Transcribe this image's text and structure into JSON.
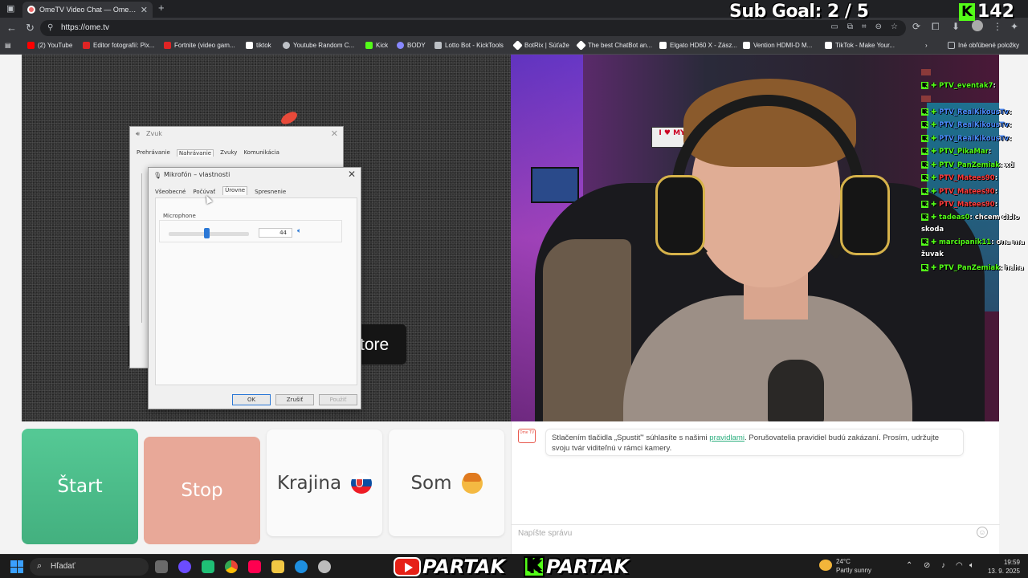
{
  "browser": {
    "tab_title": "OmeTV Video Chat — Ome…",
    "url": "https://ome.tv",
    "bookmarks": [
      {
        "label": "(2) YouTube",
        "color": "#ff0000"
      },
      {
        "label": "Editor fotografií: Pix...",
        "color": "#e02424"
      },
      {
        "label": "Fortnite (video gam...",
        "color": "#e02424"
      },
      {
        "label": "tiktok",
        "color": "#ffffff"
      },
      {
        "label": "Youtube Random C...",
        "color": "#bdc1c6"
      },
      {
        "label": "Kick",
        "color": "#53fc18"
      },
      {
        "label": "BODY",
        "color": "#8888ff"
      },
      {
        "label": "Lotto Bot - KickTools",
        "color": "#bdc1c6"
      },
      {
        "label": "BotRix | Súťaže",
        "color": "#ffffff"
      },
      {
        "label": "The best ChatBot an...",
        "color": "#ffffff"
      },
      {
        "label": "Elgato HD60 X - Zász...",
        "color": "#ffffff"
      },
      {
        "label": "Vention HDMI-D M...",
        "color": "#ffffff"
      },
      {
        "label": "TikTok - Make Your...",
        "color": "#ffffff"
      }
    ],
    "other_bookmarks": "Iné obľúbené položky"
  },
  "overlay": {
    "sub_goal": "Sub Goal:  2 / 5",
    "viewer_k": "K",
    "viewer_count": "142"
  },
  "dialogs": {
    "zvuk": {
      "title": "Zvuk",
      "tabs": [
        "Prehrávanie",
        "Nahrávanie",
        "Zvuky",
        "Komunikácia"
      ],
      "active_tab": 1
    },
    "mikrofon": {
      "title": "Mikrofón – vlastnosti",
      "tabs": [
        "Všeobecné",
        "Počúvať",
        "Úrovne",
        "Spresnenie"
      ],
      "active_tab": 2,
      "group_label": "Microphone",
      "level_value": "44",
      "level": 0.44,
      "buttons": {
        "ok": "OK",
        "cancel": "Zrušiť",
        "apply": "Použiť"
      }
    }
  },
  "video": {
    "store_fragment": "tore",
    "poster_text": "I ♥ MY"
  },
  "chat_overlay": [
    {
      "user": "",
      "text": "",
      "user_color": "green",
      "badges": "emote"
    },
    {
      "user": "PTV_eventak7",
      "text": ":",
      "user_color": "green",
      "badges": "k+"
    },
    {
      "user": "",
      "text": "",
      "user_color": "green",
      "badges": "emote"
    },
    {
      "user": "PTV_RealKikousTv",
      "text": ":",
      "user_color": "blue",
      "badges": "k+"
    },
    {
      "user": "PTV_RealKikousTv",
      "text": ":",
      "user_color": "blue",
      "badges": "k+"
    },
    {
      "user": "PTV_RealKikousTv",
      "text": ":",
      "user_color": "blue",
      "badges": "k+"
    },
    {
      "user": "PTV_PikaMar",
      "text": ":",
      "user_color": "green",
      "badges": "k+"
    },
    {
      "user": "PTV_PanZemiak",
      "text": ": xd",
      "user_color": "green",
      "badges": "k+"
    },
    {
      "user": "PTV_Matees90",
      "text": ":",
      "user_color": "red",
      "badges": "k+"
    },
    {
      "user": "PTV_Matees90",
      "text": ":",
      "user_color": "red",
      "badges": "k+"
    },
    {
      "user": "PTV_Matees90",
      "text": ":",
      "user_color": "red",
      "badges": "k+"
    },
    {
      "user": "tadeas0",
      "text": ": chcem cislo skoda",
      "user_color": "green",
      "badges": "k+",
      "wrap": true
    },
    {
      "user": "marcipanik11",
      "text": ": ona ma žuvak",
      "user_color": "green",
      "badges": "k+",
      "wrap": true
    },
    {
      "user": "PTV_PanZemiak",
      "text": ": haha",
      "user_color": "green",
      "badges": "k+"
    }
  ],
  "controls": {
    "start": "Štart",
    "stop": "Stop",
    "country": "Krajina",
    "gender": "Som"
  },
  "chat_panel": {
    "logo_text": "Ome TV",
    "notice_before": "Stlačením tlačidla „Spustiť\" súhlasíte s našimi ",
    "notice_link": "pravidlami",
    "notice_after": ". Porušovatelia pravidiel budú zakázaní. Prosím, udržujte svoju tvár viditeľnú v rámci kamery.",
    "input_placeholder": "Napíšte správu"
  },
  "taskbar": {
    "search": "Hľadať",
    "brand_youtube": "PARTAK",
    "brand_kick": "PARTAK",
    "kick_letter": "K",
    "temperature": "24°C",
    "weather": "Partly sunny",
    "time": "19:59",
    "date": "13. 9. 2025"
  },
  "colors": {
    "start": "#4dbf8b",
    "stop": "#e8a898",
    "kick_green": "#53fc18",
    "link": "#2bae7e"
  }
}
